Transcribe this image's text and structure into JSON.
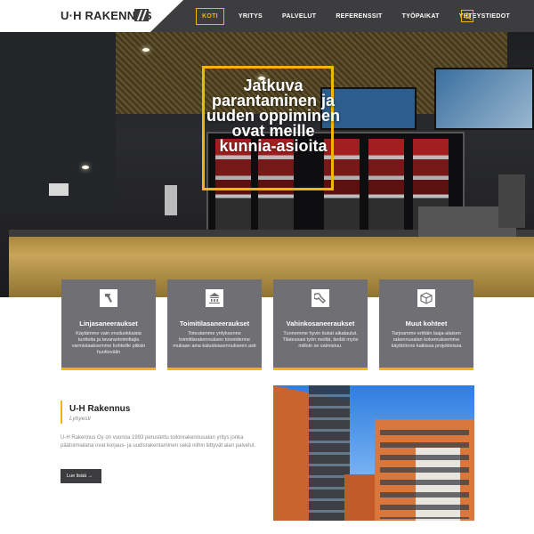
{
  "brand": {
    "logo_text": "U·H RAKENNUS",
    "accent_color": "#f2b705",
    "dark_color": "#3d3d3f"
  },
  "nav": {
    "items": [
      {
        "label": "KOTI",
        "active": true
      },
      {
        "label": "YRITYS",
        "active": false
      },
      {
        "label": "PALVELUT",
        "active": false
      },
      {
        "label": "REFERENSSIT",
        "active": false
      },
      {
        "label": "TYÖPAIKAT",
        "active": false
      },
      {
        "label": "YHTEYSTIEDOT",
        "active": false
      }
    ],
    "search_icon": "search-icon"
  },
  "hero": {
    "title": "Jatkuva parantaminen ja uuden oppiminen ovat meille kunnia-asioita"
  },
  "services": [
    {
      "icon": "hammer-icon",
      "title": "Linjasaneeraukset",
      "text": "Käytämme vain ensiluokkaisia tuotteita ja tavarantoimittajia varmistaaksemme kohteille pitkän huoltovälin"
    },
    {
      "icon": "building-icon",
      "title": "Toimitilasaneeraukset",
      "text": "Toteutamme yrityksenne toimitilarakennuksen toiveidenne mukaan aina kalusteasennukseen asti"
    },
    {
      "icon": "wrench-icon",
      "title": "Vahinkosaneeraukset",
      "text": "Tunnemme hyvin tiukat aikataulut. Tilatessasi työn meiltä, tiedät myös milloin se valmistuu."
    },
    {
      "icon": "cube-icon",
      "title": "Muut kohteet",
      "text": "Tarjoamme erittäin laaja-alaisen rakennusalan kokemuksemme käyttöönne kaikissa projekteissa"
    }
  ],
  "about": {
    "title": "U-H Rakennus",
    "subtitle": "Lyhyesti",
    "text": "U-H Rakennus Oy on vuonna 1993 perustettu toilonrakennusalan yritys jonka päätoimialana ovat korjaus- ja uudisrakentaminen sekä niihin liittyvät alan palvelut.",
    "button_label": "Lue lisää →"
  }
}
